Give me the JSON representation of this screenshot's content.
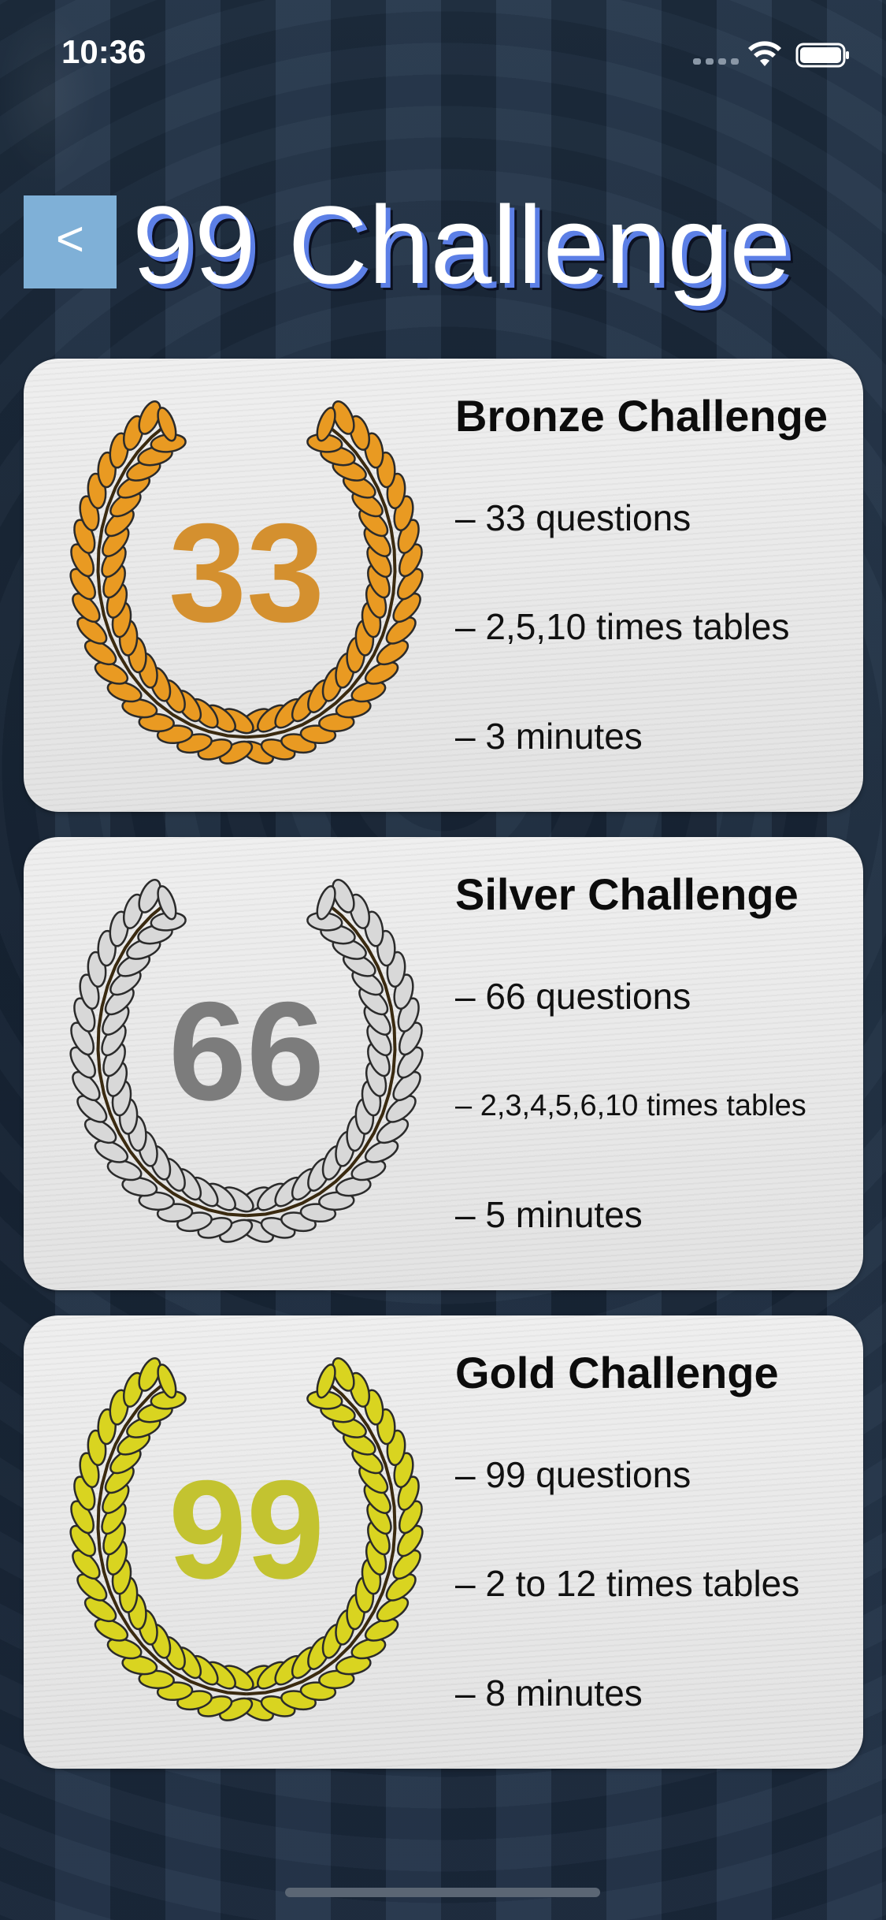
{
  "status_bar": {
    "time": "10:36"
  },
  "header": {
    "back_label": "<",
    "title": "99 Challenge"
  },
  "challenges": [
    {
      "number": "33",
      "title": "Bronze Challenge",
      "lines": [
        "– 33 questions",
        "– 2,5,10 times tables",
        "– 3 minutes"
      ],
      "color": "#d4902f",
      "leaf_color": "#e99a22"
    },
    {
      "number": "66",
      "title": "Silver Challenge",
      "lines": [
        "– 66 questions",
        "– 2,3,4,5,6,10 times tables",
        "– 5 minutes"
      ],
      "color": "#7c7c7c",
      "leaf_color": "#d8d8d8"
    },
    {
      "number": "99",
      "title": "Gold Challenge",
      "lines": [
        "– 99 questions",
        "– 2 to 12 times tables",
        "– 8 minutes"
      ],
      "color": "#c3c330",
      "leaf_color": "#d9d420"
    }
  ]
}
